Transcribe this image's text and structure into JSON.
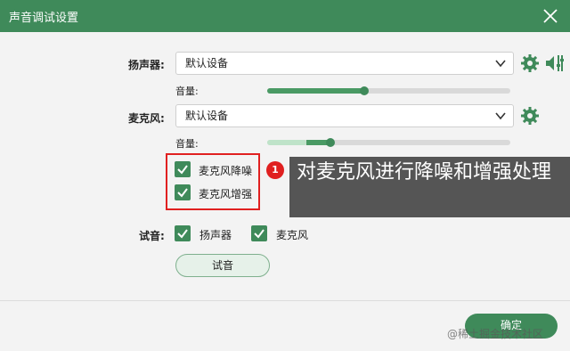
{
  "window": {
    "title": "声音调试设置"
  },
  "speaker": {
    "label": "扬声器:",
    "device": "默认设备",
    "volume_label": "音量:",
    "volume_level": 0.4
  },
  "microphone": {
    "label": "麦克风:",
    "device": "默认设备",
    "volume_label": "音量:",
    "volume_level": 0.26,
    "input_level": 0.16
  },
  "options": {
    "noise_reduction": {
      "label": "麦克风降噪",
      "checked": true
    },
    "enhance": {
      "label": "麦克风增强",
      "checked": true
    }
  },
  "test": {
    "label": "试音:",
    "speaker": {
      "label": "扬声器",
      "checked": true
    },
    "microphone": {
      "label": "麦克风",
      "checked": true
    },
    "button": "试音"
  },
  "annotation": {
    "badge": "1",
    "text": "对麦克风进行降噪和增强处理"
  },
  "footer": {
    "confirm": "确定",
    "watermark": "@稀土掘金技术社区"
  },
  "colors": {
    "accent": "#3f8a5a",
    "highlight": "#e02020",
    "tooltip_bg": "#555555"
  },
  "icons": {
    "close": "close-icon",
    "settings": "gear-icon",
    "mixer": "equalizer-icon",
    "dropdown": "chevron-down-icon",
    "check": "check-icon"
  }
}
